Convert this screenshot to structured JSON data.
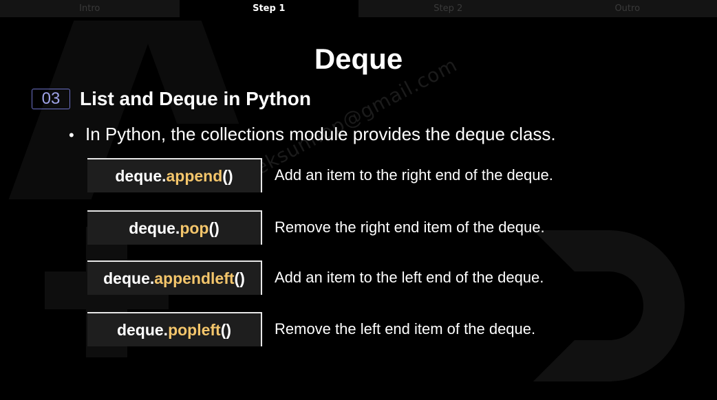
{
  "tabs": [
    {
      "label": "Intro",
      "active": false
    },
    {
      "label": "Step 1",
      "active": true
    },
    {
      "label": "Step 2",
      "active": false
    },
    {
      "label": "Outro",
      "active": false
    }
  ],
  "title": "Deque",
  "section": {
    "number": "03",
    "title": "List and Deque in Python"
  },
  "bullet": "In Python, the collections module provides the deque class.",
  "watermark": "releksunnop@gmail.com",
  "methods": [
    {
      "prefix": "deque.",
      "fn": "append",
      "suffix": "()",
      "description": "Add an item to the right end of the deque."
    },
    {
      "prefix": "deque.",
      "fn": "pop",
      "suffix": "()",
      "description": "Remove the right end item of the deque."
    },
    {
      "prefix": "deque.",
      "fn": "appendleft",
      "suffix": "()",
      "description": "Add an item to the left end of the deque."
    },
    {
      "prefix": "deque.",
      "fn": "popleft",
      "suffix": "()",
      "description": "Remove the left end item of the deque."
    }
  ],
  "colors": {
    "background": "#000000",
    "function_highlight": "#f3c56b",
    "section_badge": "#6d72c9"
  }
}
